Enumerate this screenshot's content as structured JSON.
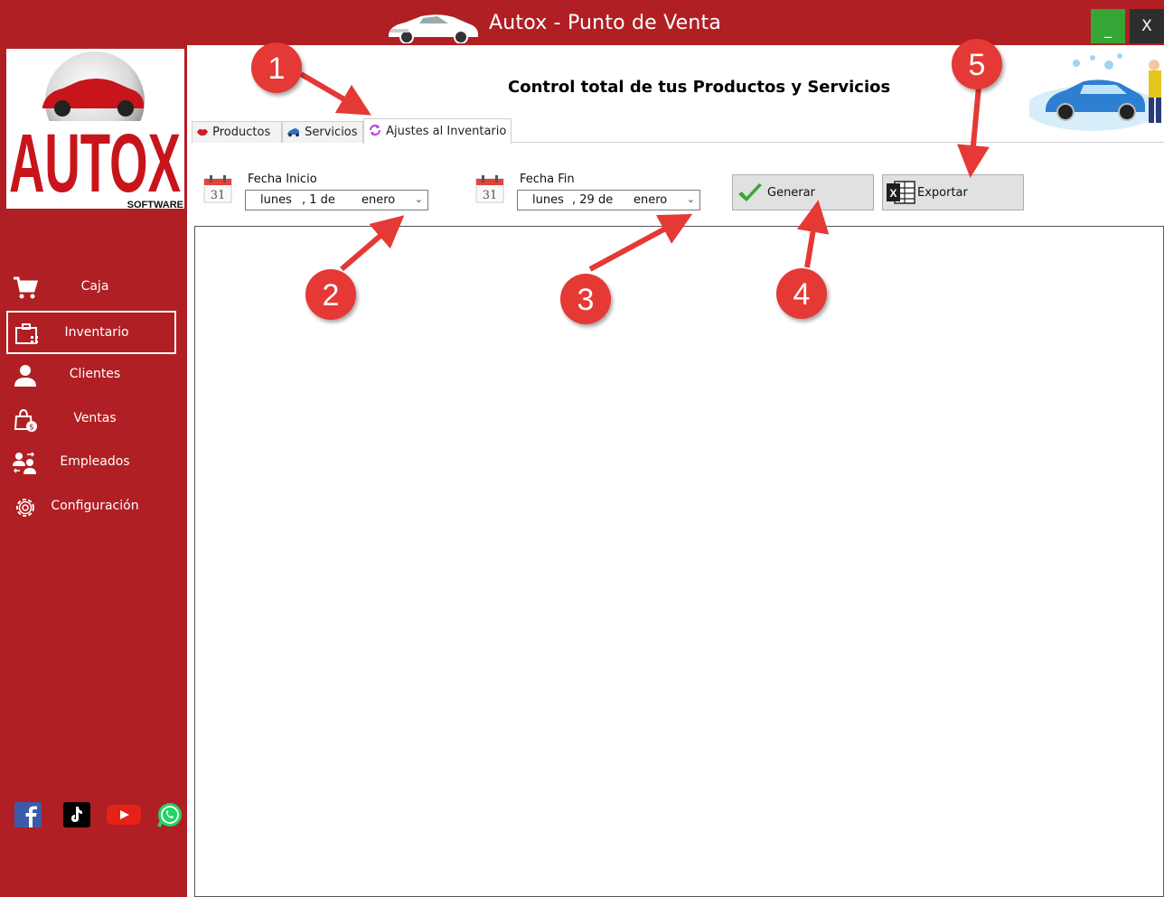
{
  "window": {
    "title": "Autox - Punto de Venta",
    "minimize_label": "_",
    "close_label": "X"
  },
  "logo": {
    "brand": "AUTOX",
    "sub": "SOFTWARE"
  },
  "sidebar": {
    "items": [
      {
        "label": "Caja",
        "icon": "cart-icon"
      },
      {
        "label": "Inventario",
        "icon": "inventory-icon",
        "active": true
      },
      {
        "label": "Clientes",
        "icon": "user-icon"
      },
      {
        "label": "Ventas",
        "icon": "shopping-bag-icon"
      },
      {
        "label": "Empleados",
        "icon": "employees-icon"
      },
      {
        "label": "Configuración",
        "icon": "gear-icon"
      }
    ],
    "social": [
      "facebook-icon",
      "tiktok-icon",
      "youtube-icon",
      "whatsapp-icon"
    ]
  },
  "header": {
    "title": "Control total de tus Productos y Servicios"
  },
  "tabs": [
    {
      "label": "Productos",
      "icon": "lips-icon"
    },
    {
      "label": "Servicios",
      "icon": "service-icon"
    },
    {
      "label": "Ajustes al Inventario",
      "icon": "refresh-icon",
      "active": true
    }
  ],
  "filters": {
    "start_label": "Fecha Inicio",
    "start_day": "lunes",
    "start_date": ", 1 de",
    "start_month": "enero",
    "end_label": "Fecha Fin",
    "end_day": "lunes",
    "end_date": ", 29 de",
    "end_month": "enero",
    "calendar_day": "31"
  },
  "buttons": {
    "generate_label": "Generar",
    "export_label": "Exportar"
  },
  "annotations": [
    "1",
    "2",
    "3",
    "4",
    "5"
  ],
  "colors": {
    "brand_red": "#b01f24",
    "annotation_red": "#e53935",
    "minimize_green": "#35a635"
  }
}
